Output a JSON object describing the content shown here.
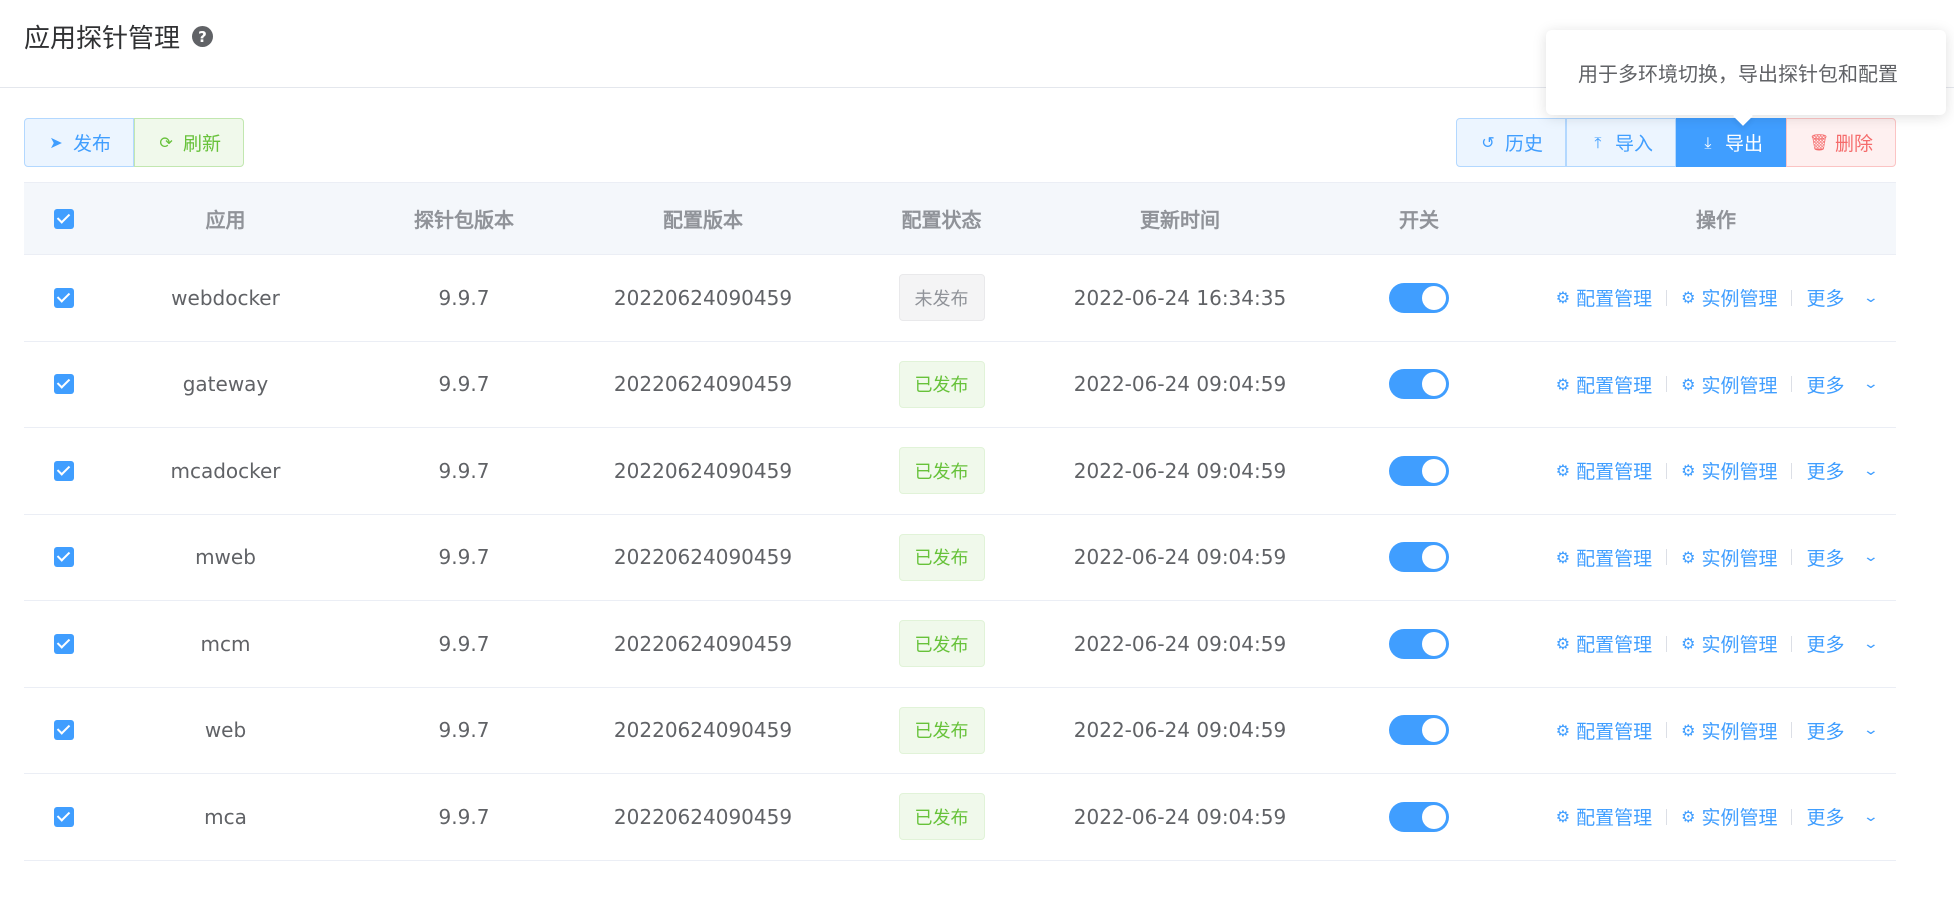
{
  "page": {
    "title": "应用探针管理"
  },
  "tooltip": {
    "text": "用于多环境切换，导出探针包和配置"
  },
  "toolbar": {
    "publish_label": "发布",
    "refresh_label": "刷新",
    "history_label": "历史",
    "import_label": "导入",
    "export_label": "导出",
    "delete_label": "删除"
  },
  "table": {
    "headers": {
      "app": "应用",
      "probe_version": "探针包版本",
      "config_version": "配置版本",
      "config_status": "配置状态",
      "update_time": "更新时间",
      "switch": "开关",
      "ops": "操作"
    },
    "ops_labels": {
      "config_manage": "配置管理",
      "instance_manage": "实例管理",
      "more": "更多"
    },
    "rows": [
      {
        "app": "webdocker",
        "probe_version": "9.9.7",
        "config_version": "20220624090459",
        "status": "未发布",
        "status_type": "info",
        "time": "2022-06-24 16:34:35",
        "enabled": true,
        "checked": true
      },
      {
        "app": "gateway",
        "probe_version": "9.9.7",
        "config_version": "20220624090459",
        "status": "已发布",
        "status_type": "success",
        "time": "2022-06-24 09:04:59",
        "enabled": true,
        "checked": true
      },
      {
        "app": "mcadocker",
        "probe_version": "9.9.7",
        "config_version": "20220624090459",
        "status": "已发布",
        "status_type": "success",
        "time": "2022-06-24 09:04:59",
        "enabled": true,
        "checked": true
      },
      {
        "app": "mweb",
        "probe_version": "9.9.7",
        "config_version": "20220624090459",
        "status": "已发布",
        "status_type": "success",
        "time": "2022-06-24 09:04:59",
        "enabled": true,
        "checked": true
      },
      {
        "app": "mcm",
        "probe_version": "9.9.7",
        "config_version": "20220624090459",
        "status": "已发布",
        "status_type": "success",
        "time": "2022-06-24 09:04:59",
        "enabled": true,
        "checked": true
      },
      {
        "app": "web",
        "probe_version": "9.9.7",
        "config_version": "20220624090459",
        "status": "已发布",
        "status_type": "success",
        "time": "2022-06-24 09:04:59",
        "enabled": true,
        "checked": true
      },
      {
        "app": "mca",
        "probe_version": "9.9.7",
        "config_version": "20220624090459",
        "status": "已发布",
        "status_type": "success",
        "time": "2022-06-24 09:04:59",
        "enabled": true,
        "checked": true
      }
    ]
  },
  "colors": {
    "primary": "#409eff",
    "success": "#67c23a",
    "danger": "#f56c6c",
    "info": "#909399"
  }
}
